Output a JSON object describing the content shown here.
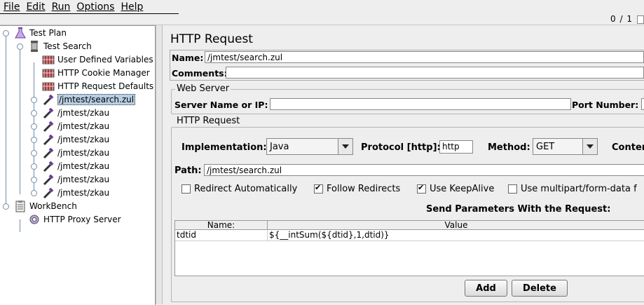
{
  "menu": [
    "File",
    "Edit",
    "Run",
    "Options",
    "Help"
  ],
  "counter": "0 / 1",
  "tree": {
    "test_plan": "Test Plan",
    "test_search": "Test Search",
    "user_vars": "User Defined Variables",
    "cookie_mgr": "HTTP Cookie Manager",
    "req_defaults": "HTTP Request Defaults",
    "samplers": [
      "/jmtest/search.zul",
      "/jmtest/zkau",
      "/jmtest/zkau",
      "/jmtest/zkau",
      "/jmtest/zkau",
      "/jmtest/zkau",
      "/jmtest/zkau",
      "/jmtest/zkau"
    ],
    "workbench": "WorkBench",
    "proxy": "HTTP Proxy Server"
  },
  "panel": {
    "title": "HTTP Request",
    "name_label": "Name:",
    "name_value": "/jmtest/search.zul",
    "comments_label": "Comments:",
    "web_server_title": "Web Server",
    "server_label": "Server Name or IP:",
    "port_label": "Port Number:",
    "http_request_title": "HTTP Request",
    "impl_label": "Implementation:",
    "impl_value": "Java",
    "protocol_label": "Protocol [http]:",
    "protocol_value": "http",
    "method_label": "Method:",
    "method_value": "GET",
    "content_label": "Conten",
    "path_label": "Path:",
    "path_value": "/jmtest/search.zul",
    "checks": [
      {
        "label": "Redirect Automatically",
        "checked": false
      },
      {
        "label": "Follow Redirects",
        "checked": true
      },
      {
        "label": "Use KeepAlive",
        "checked": true
      },
      {
        "label": "Use multipart/form-data f",
        "checked": false
      }
    ],
    "params_title": "Send Parameters With the Request:",
    "col_name": "Name:",
    "col_value": "Value",
    "row_name": "tdtid",
    "row_value": "${__intSum(${dtid},1,dtid)}",
    "add_label": "Add",
    "delete_label": "Delete"
  }
}
